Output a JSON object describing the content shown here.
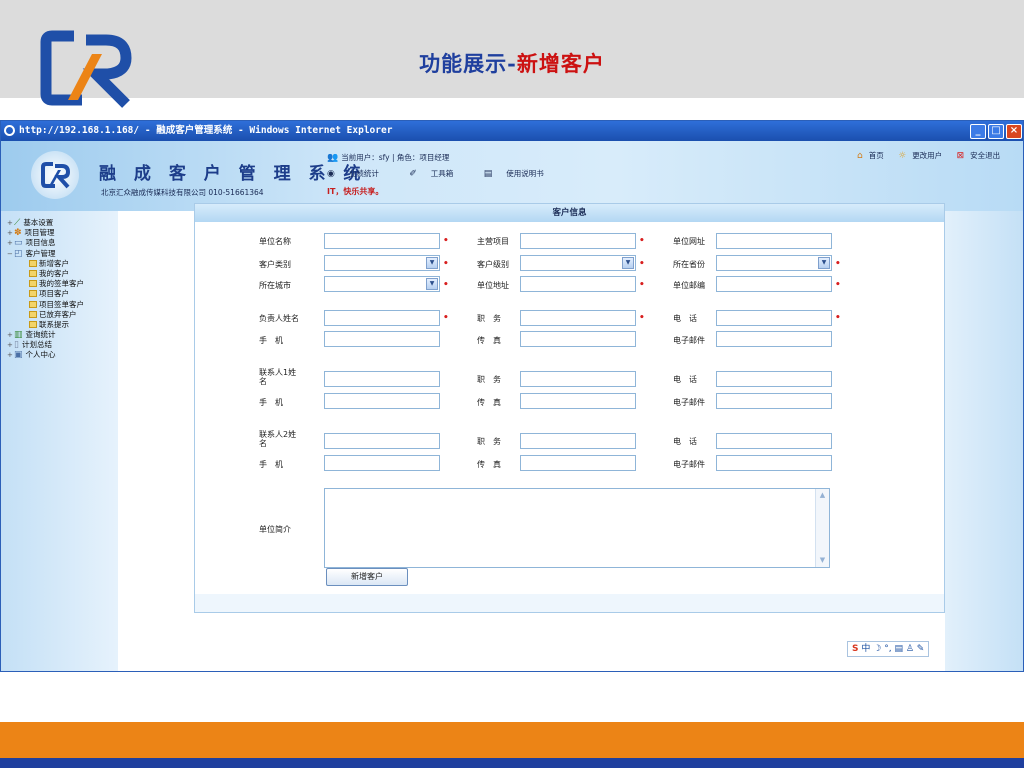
{
  "slide": {
    "title_prefix": "功能展示-",
    "title_highlight": "新增客户",
    "colors": {
      "title_blue": "#1f3f9e",
      "title_red": "#cc1111",
      "band_orange": "#ec8416",
      "band_blue": "#1f3f9e",
      "header_gray": "#dcdcdc"
    }
  },
  "browser": {
    "title": "http://192.168.1.168/ - 融成客户管理系统 - Windows Internet Explorer"
  },
  "app": {
    "name": "融 成 客 户 管 理 系 统",
    "company": "北京汇众融成传媒科技有限公司  010-51661364",
    "user_info": "当前用户：sfy  | 角色：项目经理",
    "tools": [
      "业绩统计",
      "工具箱",
      "使用说明书"
    ],
    "greeting": "IT，快乐共享。",
    "top_links": [
      "首页",
      "更改用户",
      "安全退出"
    ]
  },
  "sidebar": {
    "items": [
      {
        "label": "基本设置",
        "level": 1
      },
      {
        "label": "项目管理",
        "level": 1
      },
      {
        "label": "项目信息",
        "level": 1
      },
      {
        "label": "客户管理",
        "level": 1
      },
      {
        "label": "新增客户",
        "level": 2
      },
      {
        "label": "我的客户",
        "level": 2
      },
      {
        "label": "我的签单客户",
        "level": 2
      },
      {
        "label": "项目客户",
        "level": 2
      },
      {
        "label": "项目签单客户",
        "level": 2
      },
      {
        "label": "已放弃客户",
        "level": 2
      },
      {
        "label": "联系提示",
        "level": 2
      },
      {
        "label": "查询统计",
        "level": 1
      },
      {
        "label": "计划总结",
        "level": 1
      },
      {
        "label": "个人中心",
        "level": 1
      }
    ]
  },
  "form": {
    "section_title": "客户信息",
    "labels": {
      "unit_name": "单位名称",
      "main_project": "主营项目",
      "unit_website": "单位网址",
      "customer_type": "客户类别",
      "customer_level": "客户级别",
      "province": "所在省份",
      "city": "所在城市",
      "unit_address": "单位地址",
      "unit_email": "单位邮编",
      "manager_name": "负责人姓名",
      "position": "职　务",
      "phone": "电　话",
      "mobile": "手　机",
      "fax": "传　真",
      "email": "电子邮件",
      "contact1_name": "联系人1姓名",
      "contact2_name": "联系人2姓名",
      "intro": "单位简介"
    },
    "submit_label": "新增客户"
  }
}
